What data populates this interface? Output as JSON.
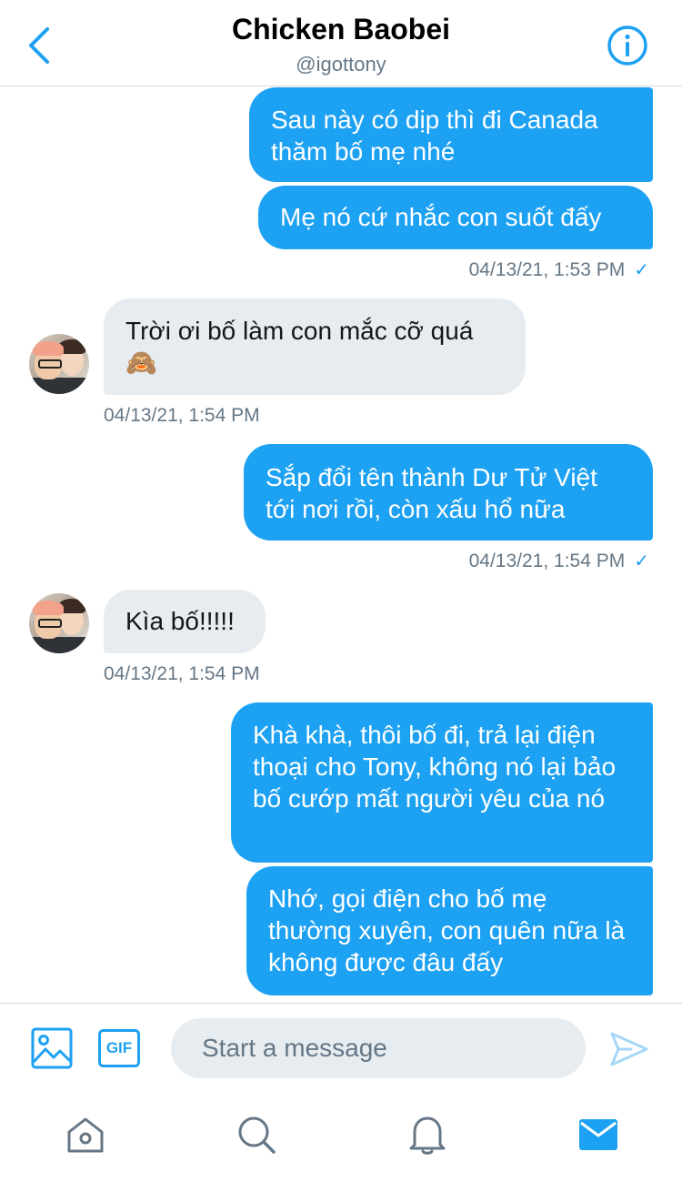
{
  "header": {
    "title": "Chicken Baobei",
    "handle": "@igottony",
    "back_icon": "chevron-left-icon",
    "info_icon": "info-icon"
  },
  "messages": [
    {
      "side": "out",
      "text": "Sau này có dịp thì đi Canada thăm bố mẹ nhé"
    },
    {
      "side": "out",
      "text": "Mẹ nó cứ nhắc con suốt đấy",
      "timestamp": "04/13/21, 1:53 PM",
      "read_mark": "✓"
    },
    {
      "side": "in",
      "text": "Trời ơi bố làm con mắc cỡ quá",
      "emoji": "🙈",
      "timestamp": "04/13/21, 1:54 PM"
    },
    {
      "side": "out",
      "text": "Sắp đổi tên thành Dư Tử Việt tới nơi rồi, còn xấu hổ nữa",
      "timestamp": "04/13/21, 1:54 PM",
      "read_mark": "✓"
    },
    {
      "side": "in",
      "text": "Kìa bố!!!!!",
      "timestamp": "04/13/21, 1:54 PM"
    },
    {
      "side": "out",
      "text": "Khà khà, thôi bố đi, trả lại điện thoại cho Tony, không nó lại bảo bố cướp mất người yêu của nó"
    },
    {
      "side": "out",
      "text": "Nhớ, gọi điện cho bố mẹ thường xuyên, con quên nữa là không được đâu đấy"
    }
  ],
  "composer": {
    "placeholder": "Start a message",
    "gif_label": "GIF",
    "image_icon": "image-icon",
    "send_icon": "send-icon"
  },
  "tabbar": {
    "items": [
      "home-icon",
      "search-icon",
      "bell-icon",
      "mail-icon"
    ],
    "active": "mail-icon"
  },
  "colors": {
    "accent": "#1da1f2",
    "incoming_bubble": "#e6ecf0",
    "secondary_text": "#657786"
  }
}
